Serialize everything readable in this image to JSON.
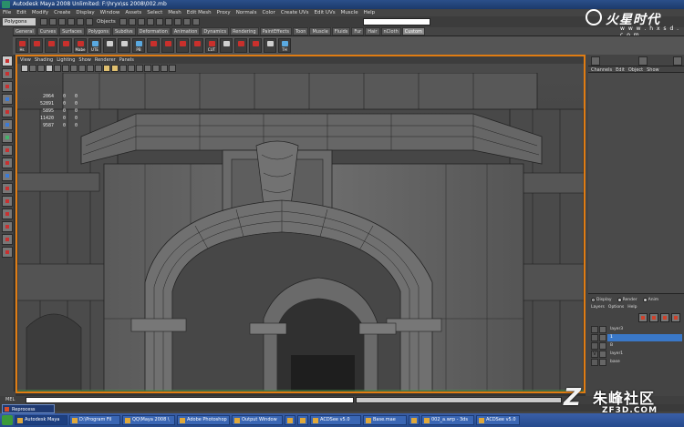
{
  "window": {
    "title": "Autodesk Maya 2008 Unlimited: F:\\hryx\\ss 2008\\002.mb"
  },
  "menubar": {
    "items": [
      "File",
      "Edit",
      "Modify",
      "Create",
      "Display",
      "Window",
      "Assets",
      "Select",
      "Mesh",
      "Edit Mesh",
      "Proxy",
      "Normals",
      "Color",
      "Create UVs",
      "Edit UVs",
      "Muscle",
      "Help"
    ]
  },
  "statusline": {
    "mode": "Polygons",
    "selection_mode_label": "Objects"
  },
  "shelf": {
    "tabs": [
      "General",
      "Curves",
      "Surfaces",
      "Polygons",
      "Subdivs",
      "Deformation",
      "Animation",
      "Dynamics",
      "Rendering",
      "PaintEffects",
      "Toon",
      "Muscle",
      "Fluids",
      "Fur",
      "Hair",
      "nCloth",
      "Custom"
    ],
    "active_tab": "Custom",
    "buttons": [
      {
        "label": "Hs",
        "color": "red"
      },
      {
        "label": "",
        "color": "red"
      },
      {
        "label": "",
        "color": "red"
      },
      {
        "label": "",
        "color": "red"
      },
      {
        "label": "Mabe",
        "color": "red"
      },
      {
        "label": "UTE",
        "color": "blue"
      },
      {
        "label": "",
        "color": "gray"
      },
      {
        "label": "",
        "color": "gray"
      },
      {
        "label": "PB",
        "color": "blue"
      },
      {
        "label": "",
        "color": "red"
      },
      {
        "label": "",
        "color": "red"
      },
      {
        "label": "",
        "color": "red"
      },
      {
        "label": "",
        "color": "red"
      },
      {
        "label": "CUT",
        "color": "red"
      },
      {
        "label": "",
        "color": "gray"
      },
      {
        "label": "",
        "color": "red"
      },
      {
        "label": "",
        "color": "red"
      },
      {
        "label": "",
        "color": "gray"
      },
      {
        "label": "TH",
        "color": "blue"
      }
    ]
  },
  "logo_top": {
    "text_cn": "火星时代",
    "url": "w w w . h x s d . c o m"
  },
  "panel": {
    "menus": [
      "View",
      "Shading",
      "Lighting",
      "Show",
      "Renderer",
      "Panels"
    ]
  },
  "hud": {
    "rows": [
      {
        "value": "2064",
        "a": "0",
        "b": "0"
      },
      {
        "value": "52891",
        "a": "0",
        "b": "0"
      },
      {
        "value": "5895",
        "a": "0",
        "b": "0"
      },
      {
        "value": "11420",
        "a": "0",
        "b": "0"
      },
      {
        "value": "9587",
        "a": "0",
        "b": "0"
      }
    ]
  },
  "channel_box": {
    "menus": [
      "Channels",
      "Edit",
      "Object",
      "Show"
    ]
  },
  "layer_editor": {
    "modes": [
      "Display",
      "Render",
      "Anim"
    ],
    "selected_mode": "Display",
    "menus": [
      "Layers",
      "Options",
      "Help"
    ],
    "layers": [
      {
        "name": "layer3",
        "visible": "",
        "selected": false
      },
      {
        "name": "1",
        "visible": "",
        "selected": true
      },
      {
        "name": "B",
        "visible": "",
        "selected": false
      },
      {
        "name": "layer1",
        "visible": "V",
        "selected": false
      },
      {
        "name": "base",
        "visible": "",
        "selected": false
      }
    ]
  },
  "command": {
    "label": "MEL"
  },
  "reprocess": {
    "label": "Reprocess"
  },
  "taskbar": {
    "items": [
      "Autodesk Maya",
      "D:\\Program Fil",
      "QQ\\Maya 2008 \\",
      "Adobe Photoshop",
      "Output Window",
      "",
      "",
      "ACDSee v5.0",
      "Base.mae",
      "",
      "002_a.wrp - 3ds",
      "ACDSee v5.0"
    ]
  },
  "watermark": {
    "text_cn": "朱峰社区",
    "url": "ZF3D.COM"
  }
}
